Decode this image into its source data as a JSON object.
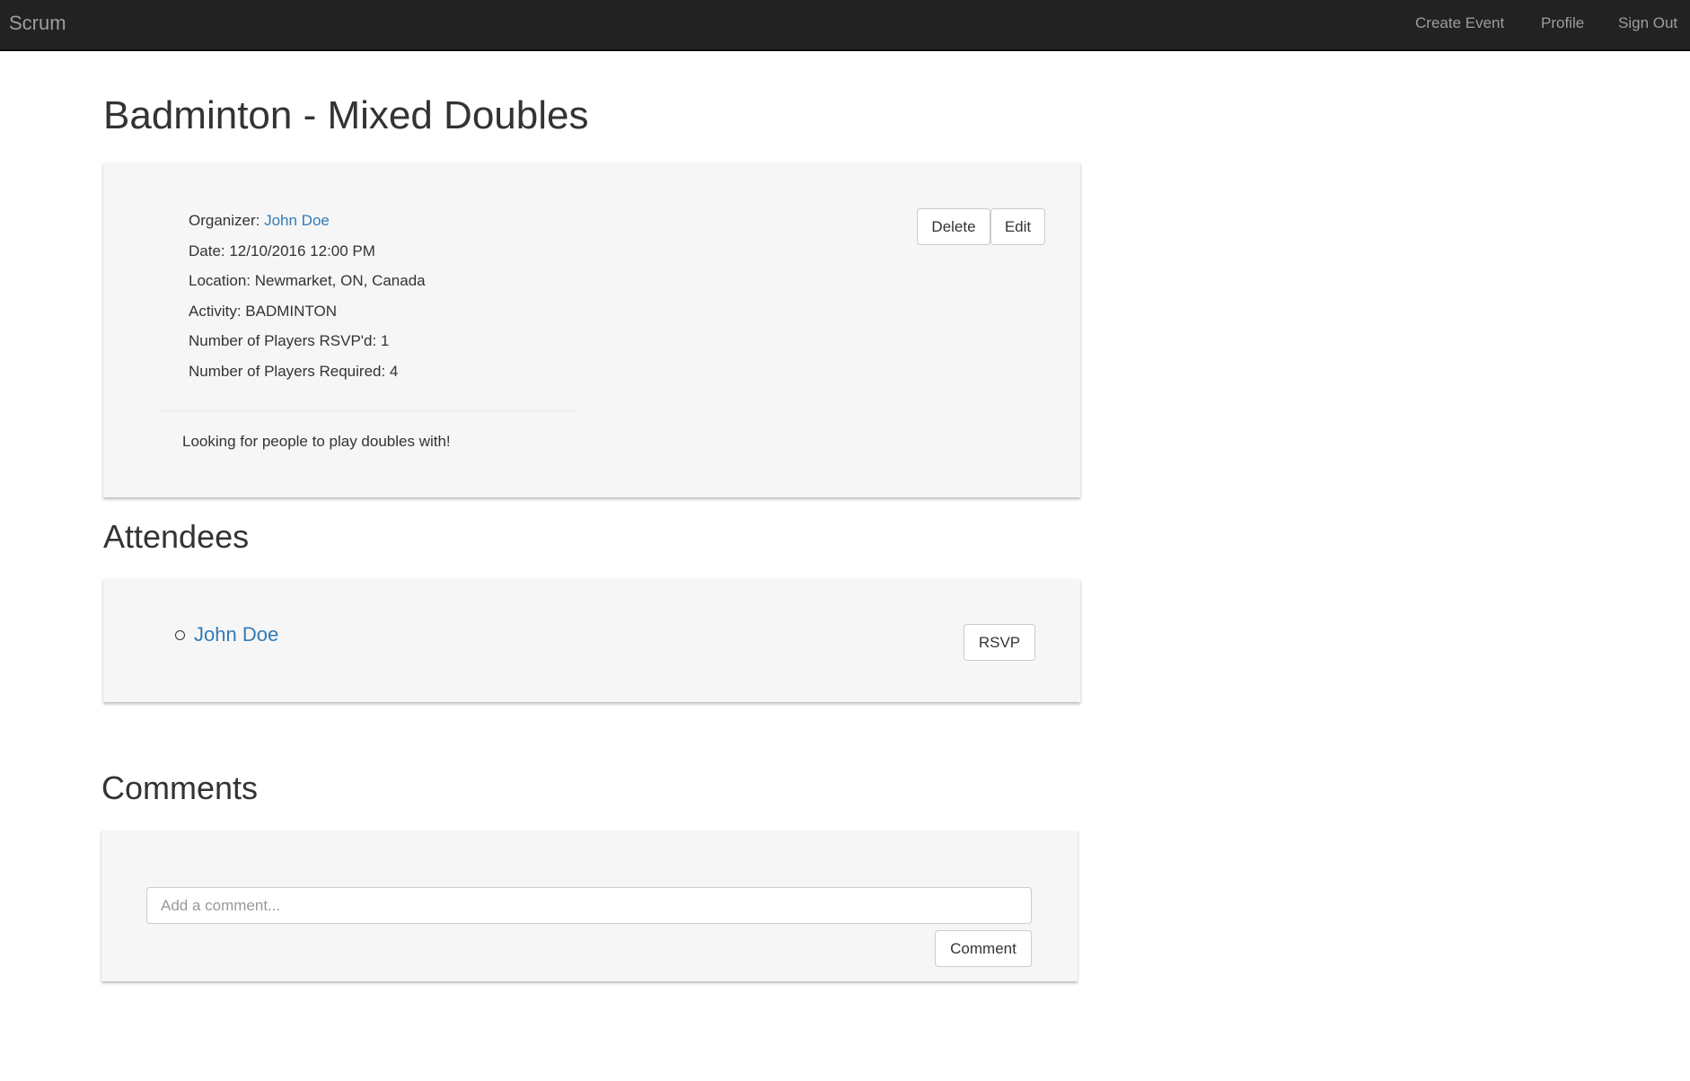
{
  "nav": {
    "brand": "Scrum",
    "links": [
      "Create Event",
      "Profile",
      "Sign Out"
    ]
  },
  "event": {
    "title": "Badminton - Mixed Doubles",
    "organizer_label": "Organizer: ",
    "organizer": "John Doe",
    "date": "Date: 12/10/2016 12:00 PM",
    "location": "Location: Newmarket, ON, Canada",
    "activity": "Activity: BADMINTON",
    "rsvp_count": "Number of Players RSVP'd: 1",
    "required": "Number of Players Required: 4",
    "description": "Looking for people to play doubles with!",
    "delete_label": "Delete",
    "edit_label": "Edit"
  },
  "attendees": {
    "heading": "Attendees",
    "list": [
      "John Doe"
    ],
    "rsvp_label": "RSVP"
  },
  "comments": {
    "heading": "Comments",
    "placeholder": "Add a comment...",
    "value": "",
    "submit_label": "Comment"
  },
  "colors": {
    "navbar": "#222222",
    "link": "#337ab7",
    "panel": "#f6f6f6"
  }
}
